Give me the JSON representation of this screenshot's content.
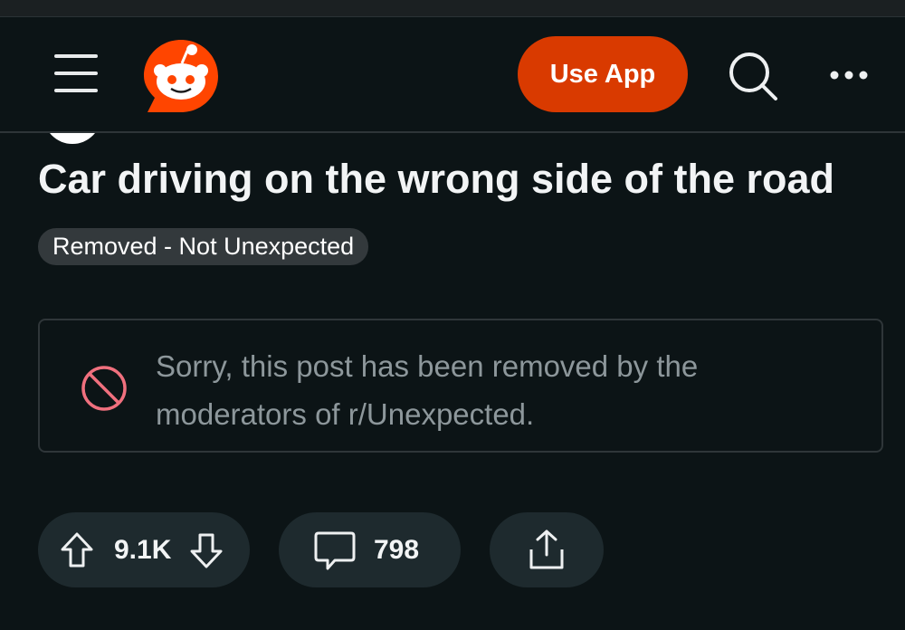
{
  "header": {
    "use_app_label": "Use App",
    "icons": [
      "hamburger-menu-icon",
      "reddit-logo-icon",
      "search-icon",
      "more-options-icon"
    ],
    "accent_color": "#d93a00",
    "logo_color": "#ff4500"
  },
  "post": {
    "title": "Car driving on the wrong side of the road",
    "flair": "Removed - Not Unexpected",
    "removed_notice": "Sorry, this post has been removed by the moderators of r/Unexpected.",
    "removed_icon": "ban-icon",
    "removed_icon_color": "#f0707e"
  },
  "actions": {
    "vote_count": "9.1K",
    "comment_count": "798",
    "icons": [
      "upvote-icon",
      "downvote-icon",
      "comment-icon",
      "share-icon"
    ]
  }
}
